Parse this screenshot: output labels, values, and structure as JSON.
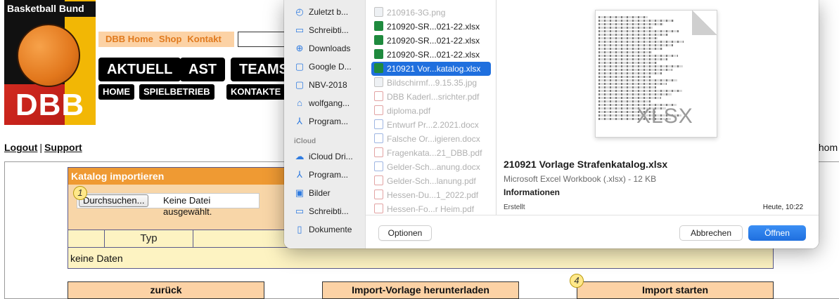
{
  "logo": {
    "title": "Basketball Bund",
    "letters": "DBB"
  },
  "topnav": {
    "home": "DBB Home",
    "shop": "Shop",
    "kontakt": "Kontakt"
  },
  "mainnav": {
    "aktuell": "AKTUELL",
    "ast": "AST",
    "teams": "TEAMS"
  },
  "subnav": {
    "home": "HOME",
    "spielbetrieb": "SPIELBETRIEB",
    "kontakte": "KONTAKTE"
  },
  "userlinks": {
    "logout": "Logout",
    "separator": "|",
    "support": "Support",
    "truncated": "thom"
  },
  "katalog": {
    "title": "Katalog importieren",
    "marker1": "1",
    "browse_label": "Durchsuchen...",
    "file_status": "Keine Datei ausgewählt.",
    "col_typ": "Typ",
    "empty": "keine Daten"
  },
  "actions": {
    "back": "zurück",
    "download": "Import-Vorlage herunterladen",
    "marker4": "4",
    "start": "Import starten"
  },
  "dialog": {
    "sidebar": {
      "favorites": [
        {
          "icon": "clock-icon",
          "glyph": "◴",
          "label": "Zuletzt b..."
        },
        {
          "icon": "desktop-icon",
          "glyph": "▭",
          "label": "Schreibti..."
        },
        {
          "icon": "download-icon",
          "glyph": "⊕",
          "label": "Downloads"
        },
        {
          "icon": "folder-icon",
          "glyph": "▢",
          "label": "Google D..."
        },
        {
          "icon": "folder-icon",
          "glyph": "▢",
          "label": "NBV-2018"
        },
        {
          "icon": "home-icon",
          "glyph": "⌂",
          "label": "wolfgang..."
        },
        {
          "icon": "applications-icon",
          "glyph": "⅄",
          "label": "Program..."
        }
      ],
      "icloud_header": "iCloud",
      "icloud": [
        {
          "icon": "cloud-icon",
          "glyph": "☁",
          "label": "iCloud Dri..."
        },
        {
          "icon": "applications-icon",
          "glyph": "⅄",
          "label": "Program..."
        },
        {
          "icon": "pictures-icon",
          "glyph": "▣",
          "label": "Bilder"
        },
        {
          "icon": "desktop-icon",
          "glyph": "▭",
          "label": "Schreibti..."
        },
        {
          "icon": "document-icon",
          "glyph": "▯",
          "label": "Dokumente"
        }
      ]
    },
    "files": [
      {
        "name": "210916-3G.png",
        "type": "img",
        "state": "disabled"
      },
      {
        "name": "210920-SR...021-22.xlsx",
        "type": "xls",
        "state": "enabled"
      },
      {
        "name": "210920-SR...021-22.xlsx",
        "type": "xls",
        "state": "enabled"
      },
      {
        "name": "210920-SR...021-22.xlsx",
        "type": "xls",
        "state": "enabled"
      },
      {
        "name": "210921 Vor...katalog.xlsx",
        "type": "xls",
        "state": "selected"
      },
      {
        "name": "Bildschirmf...9.15.35.jpg",
        "type": "img",
        "state": "disabled"
      },
      {
        "name": "DBB Kaderl...srichter.pdf",
        "type": "pdf",
        "state": "disabled"
      },
      {
        "name": "diploma.pdf",
        "type": "pdf",
        "state": "disabled"
      },
      {
        "name": "Entwurf Pr...2.2021.docx",
        "type": "doc",
        "state": "disabled"
      },
      {
        "name": "Falsche Or...igieren.docx",
        "type": "doc",
        "state": "disabled"
      },
      {
        "name": "Fragenkata...21_DBB.pdf",
        "type": "pdf",
        "state": "disabled"
      },
      {
        "name": "Gelder-Sch...anung.docx",
        "type": "doc",
        "state": "disabled"
      },
      {
        "name": "Gelder-Sch...lanung.pdf",
        "type": "pdf",
        "state": "disabled"
      },
      {
        "name": "Hessen-Du...1_2022.pdf",
        "type": "pdf",
        "state": "disabled"
      },
      {
        "name": "Hessen-Fo...r Heim.pdf",
        "type": "pdf",
        "state": "disabled"
      }
    ],
    "preview": {
      "thumb_label": "XLSX",
      "name": "210921 Vorlage Strafenkatalog.xlsx",
      "kind": "Microsoft Excel Workbook (.xlsx) - 12 KB",
      "info_header": "Informationen",
      "created_label": "Erstellt",
      "created_value": "Heute, 10:22"
    },
    "buttons": {
      "options": "Optionen",
      "cancel": "Abbrechen",
      "open": "Öffnen"
    }
  },
  "colors": {
    "accent": "#1f6fde",
    "orange": "#ef9a33",
    "peach": "#fcd2a5",
    "cream": "#fdf3c2"
  }
}
